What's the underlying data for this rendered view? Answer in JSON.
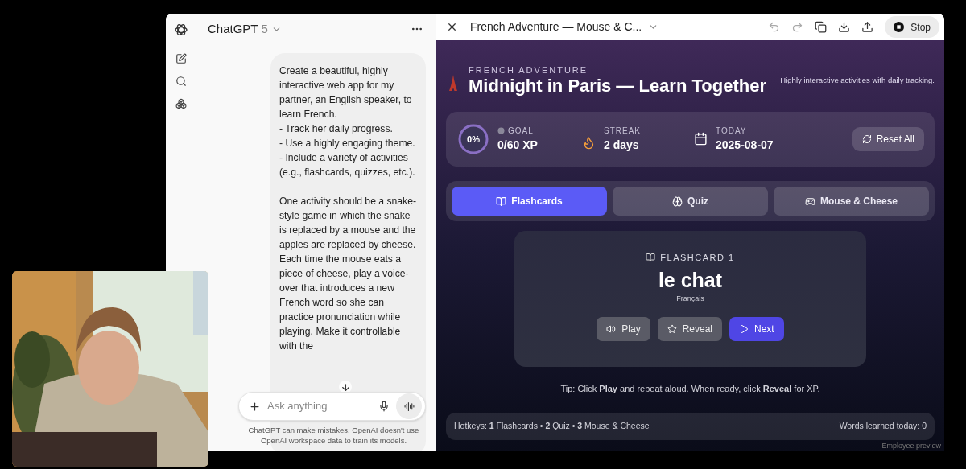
{
  "chat": {
    "model_name": "ChatGPT",
    "model_version": "5",
    "message": "Create a beautiful, highly interactive web app for my partner, an English speaker, to learn French.\n- Track her daily progress.\n- Use a highly engaging theme.\n- Include a variety of activities (e.g., flashcards, quizzes, etc.).\n\nOne activity should be a snake-style game in which the snake is replaced by a mouse and the apples are replaced by cheese. Each time the mouse eats a piece of cheese, play a voice-over that introduces a new French word so she can practice pronunciation while playing. Make it controllable with the",
    "composer": {
      "placeholder": "Ask anything"
    },
    "disclaimer": "ChatGPT can make mistakes. OpenAI doesn't use OpenAI workspace data to train its models."
  },
  "canvas": {
    "title": "French Adventure — Mouse & C...",
    "stop_label": "Stop",
    "app": {
      "eyebrow": "FRENCH ADVENTURE",
      "title": "Midnight in Paris — Learn Together",
      "tagline": "Highly interactive activities with daily tracking.",
      "stats": {
        "goal": {
          "ring_text": "0%",
          "level": 0,
          "label": "GOAL",
          "value": "0/60 XP"
        },
        "streak": {
          "label": "STREAK",
          "value": "2 days"
        },
        "today": {
          "label": "TODAY",
          "value": "2025-08-07"
        },
        "reset_label": "Reset All"
      },
      "tabs": [
        {
          "label": "Flashcards",
          "selected": true
        },
        {
          "label": "Quiz",
          "selected": false
        },
        {
          "label": "Mouse & Cheese",
          "selected": false
        }
      ],
      "flashcard": {
        "label": "FLASHCARD 1",
        "word": "le chat",
        "language": "Français",
        "buttons": [
          {
            "label": "Play",
            "kind": "secondary"
          },
          {
            "label": "Reveal",
            "kind": "secondary"
          },
          {
            "label": "Next",
            "kind": "primary"
          }
        ]
      },
      "tip": "Tip: Click **Play** and repeat aloud. When ready, click **Reveal** for XP.",
      "footer": {
        "hotkeys": "Hotkeys: **1** Flashcards • **2** Quiz • **3** Mouse & Cheese",
        "words_learned": "Words learned today: 0"
      },
      "preview_label": "Employee preview"
    }
  }
}
